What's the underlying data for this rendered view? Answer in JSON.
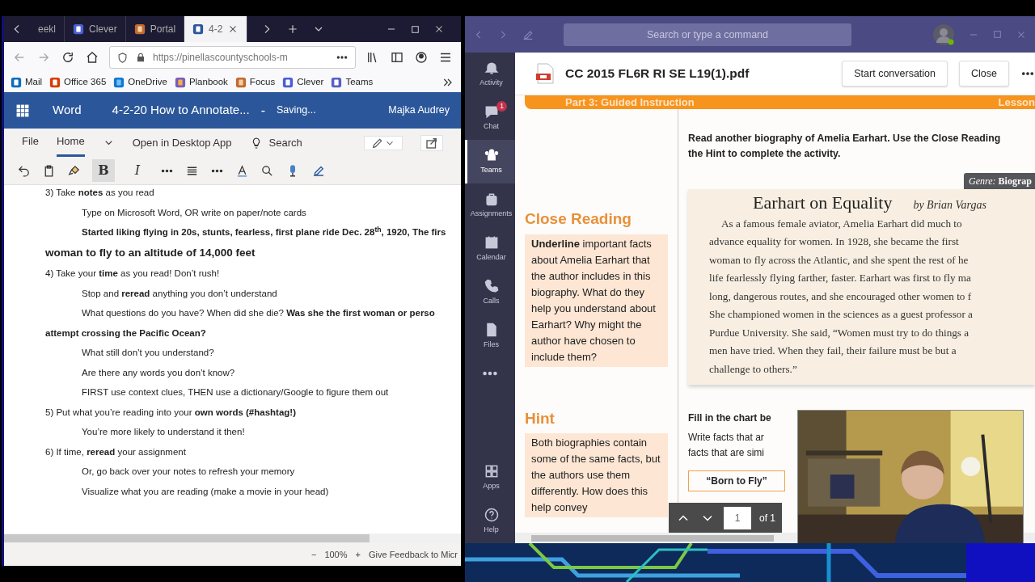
{
  "browser": {
    "tabs": [
      {
        "label": "eekl",
        "selected": false
      },
      {
        "label": "Clever",
        "selected": false
      },
      {
        "label": "Portal",
        "selected": false
      },
      {
        "label": "4-2",
        "selected": true
      }
    ],
    "url": "https://pinellascountyschools-m",
    "bookmarks": [
      "Mail",
      "Office 365",
      "OneDrive",
      "Planbook",
      "Focus",
      "Clever",
      "Teams"
    ]
  },
  "word": {
    "app": "Word",
    "doc_title": "4-2-20 How to Annotate...",
    "separator": "-",
    "save_status": "Saving...",
    "user": "Majka Audrey",
    "ribbon_tabs": [
      {
        "label": "File",
        "selected": false
      },
      {
        "label": "Home",
        "selected": true
      }
    ],
    "open_desktop": "Open in Desktop App",
    "search": "Search",
    "format_buttons": [
      {
        "label": "B",
        "selected": true
      },
      {
        "label": "I",
        "selected": false
      }
    ],
    "lines": [
      {
        "kind": "item",
        "text": "3) Take **notes** as you read"
      },
      {
        "kind": "sub",
        "text": "Type on Microsoft Word, OR write on paper/note cards"
      },
      {
        "kind": "note",
        "text": "Started liking flying in 20s, stunts, fearless, first plane ride Dec. 28$^{th}$, 1920, The firs"
      },
      {
        "kind": "heading",
        "text": "woman to fly to an altitude of 14,000 feet"
      },
      {
        "kind": "item",
        "text": "4) Take your **time** as you read! Don’t rush!"
      },
      {
        "kind": "sub",
        "text": "Stop and **reread** anything you don’t understand"
      },
      {
        "kind": "sub",
        "text": "What questions do you have? When did she die? **Was she the first woman or perso**"
      },
      {
        "kind": "cont",
        "text": "attempt crossing the Pacific Ocean?"
      },
      {
        "kind": "sub",
        "text": "What still don’t you understand?"
      },
      {
        "kind": "sub",
        "text": "Are there any words you don’t know?"
      },
      {
        "kind": "sub",
        "text": "FIRST use context clues, THEN use a dictionary/Google to figure them out"
      },
      {
        "kind": "item",
        "text": "5) Put what you’re reading into your **own words (#hashtag!)**"
      },
      {
        "kind": "sub",
        "text": "You’re more likely to understand it then!"
      },
      {
        "kind": "item",
        "text": "6) If time, **reread** your assignment"
      },
      {
        "kind": "sub",
        "text": "Or, go back over your notes to refresh your memory"
      },
      {
        "kind": "sub",
        "text": "Visualize what you are reading (make a movie in your head)"
      }
    ],
    "status": {
      "zoom_out": "−",
      "zoom": "100%",
      "zoom_in": "+",
      "feedback": "Give Feedback to Micr"
    }
  },
  "teams": {
    "search": {
      "placeholder": "Search or type a command"
    },
    "nav": [
      {
        "label": "Activity",
        "selected": false
      },
      {
        "label": "Chat",
        "selected": false,
        "badge": "1"
      },
      {
        "label": "Teams",
        "selected": true
      },
      {
        "label": "Assignments",
        "selected": false
      },
      {
        "label": "Calendar",
        "selected": false
      },
      {
        "label": "Calls",
        "selected": false
      },
      {
        "label": "Files",
        "selected": false
      }
    ],
    "nav_bottom": [
      {
        "label": "Apps",
        "selected": false
      },
      {
        "label": "Help",
        "selected": false
      }
    ],
    "file_name": "CC 2015 FL6R RI SE L19(1).pdf",
    "buttons": [
      "Start conversation",
      "Close"
    ],
    "pdf": {
      "banner": "Part 3: Guided Instruction",
      "banner_right": "Lesson",
      "instructions": [
        "Read another biography of Amelia Earhart. Use the Close Reading",
        "the Hint to complete the activity."
      ],
      "genre": "*Genre:* **Biograp**",
      "close_reading": {
        "title": "Close Reading",
        "text": "**Underline** important facts about Amelia Earhart that the author includes in this biography. What do they help you understand about Earhart? Why might the author have chosen to include them?"
      },
      "passage": {
        "title": "Earhart on Equality",
        "byline": "by Brian Vargas",
        "lines": [
          "As a famous female aviator, Amelia Earhart did much to",
          "advance equality for women. In 1928, she became the first",
          "woman to fly across the Atlantic, and she spent the rest of he",
          "life fearlessly flying farther, faster. Earhart was first to fly ma",
          "long, dangerous routes, and she encouraged other women to f",
          "She championed women in the sciences as a guest professor a",
          "Purdue University. She said, “Women must try to do things a",
          "men have tried. When they fail, their failure must be but a",
          "challenge to others.”"
        ]
      },
      "hint": {
        "title": "Hint",
        "text": "Both biographies contain some of the same facts, but the authors use them differently. How does this help convey"
      },
      "chart_prompt": "Fill in the chart be",
      "chart_text": [
        "Write facts that ar",
        "facts that are simi"
      ],
      "chart_column": "“Born to Fly”",
      "page_nav": {
        "page": "1",
        "total": "of 1"
      }
    }
  }
}
